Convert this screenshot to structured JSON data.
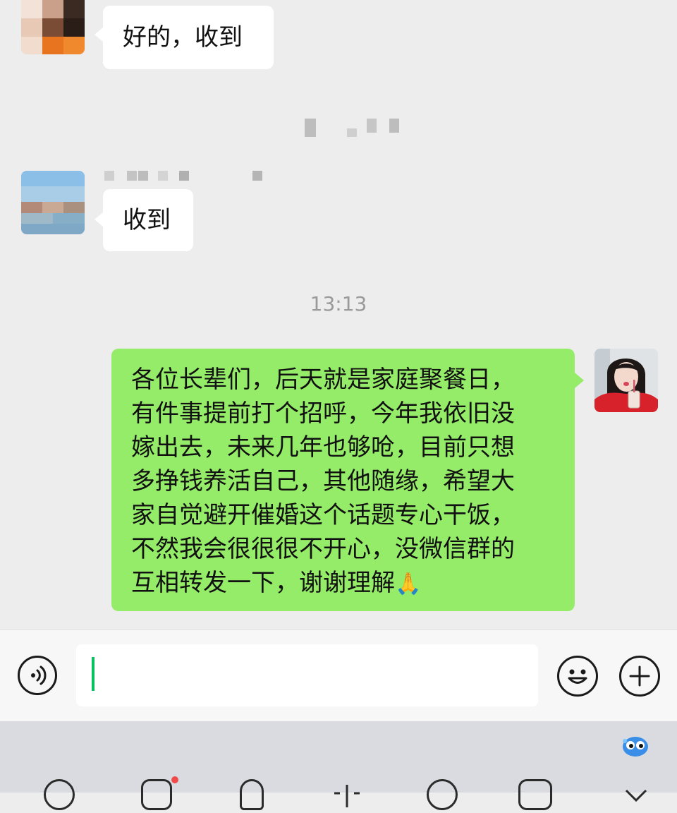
{
  "messages": [
    {
      "direction": "in",
      "text": "好的，收到"
    },
    {
      "direction": "in",
      "text": "收到"
    }
  ],
  "timestamp": "13:13",
  "outgoing": {
    "lines": [
      "各位长辈们，后天就是家庭聚餐日，",
      "有件事提前打个招呼，今年我依旧没",
      "嫁出去，未来几年也够呛，目前只想",
      "多挣钱养活自己，其他随缘，希望大",
      "家自觉避开催婚这个话题专心干饭，",
      "不然我会很很很不开心，没微信群的",
      "互相转发一下，谢谢理解"
    ],
    "emoji": "🙏"
  },
  "input": {
    "value": ""
  },
  "icons": {
    "voice": "voice-icon",
    "emoji": "emoji-face-icon",
    "more": "plus-icon",
    "keyboard_mascot": "mascot-icon"
  },
  "colors": {
    "chat_bg": "#ededed",
    "out_bubble": "#95ec69",
    "in_bubble": "#ffffff",
    "caret": "#07c160"
  }
}
